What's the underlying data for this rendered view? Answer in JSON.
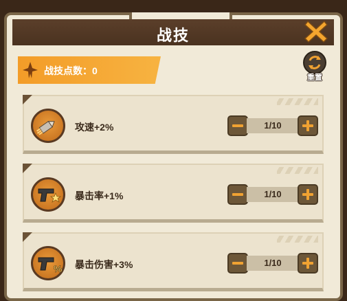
{
  "header": {
    "title": "战技"
  },
  "points": {
    "label": "战技点数：0"
  },
  "reset": {
    "label": "重置"
  },
  "skills": [
    {
      "name": "攻速+2%",
      "level": "1/10",
      "icon": "bullet-icon"
    },
    {
      "name": "暴击率+1%",
      "level": "1/10",
      "icon": "pistol-star-icon"
    },
    {
      "name": "暴击伤害+3%",
      "level": "1/10",
      "icon": "pistol-percent-icon"
    }
  ],
  "colors": {
    "accent": "#f39c28",
    "header": "#4a3220",
    "panel": "#f1ead8"
  }
}
